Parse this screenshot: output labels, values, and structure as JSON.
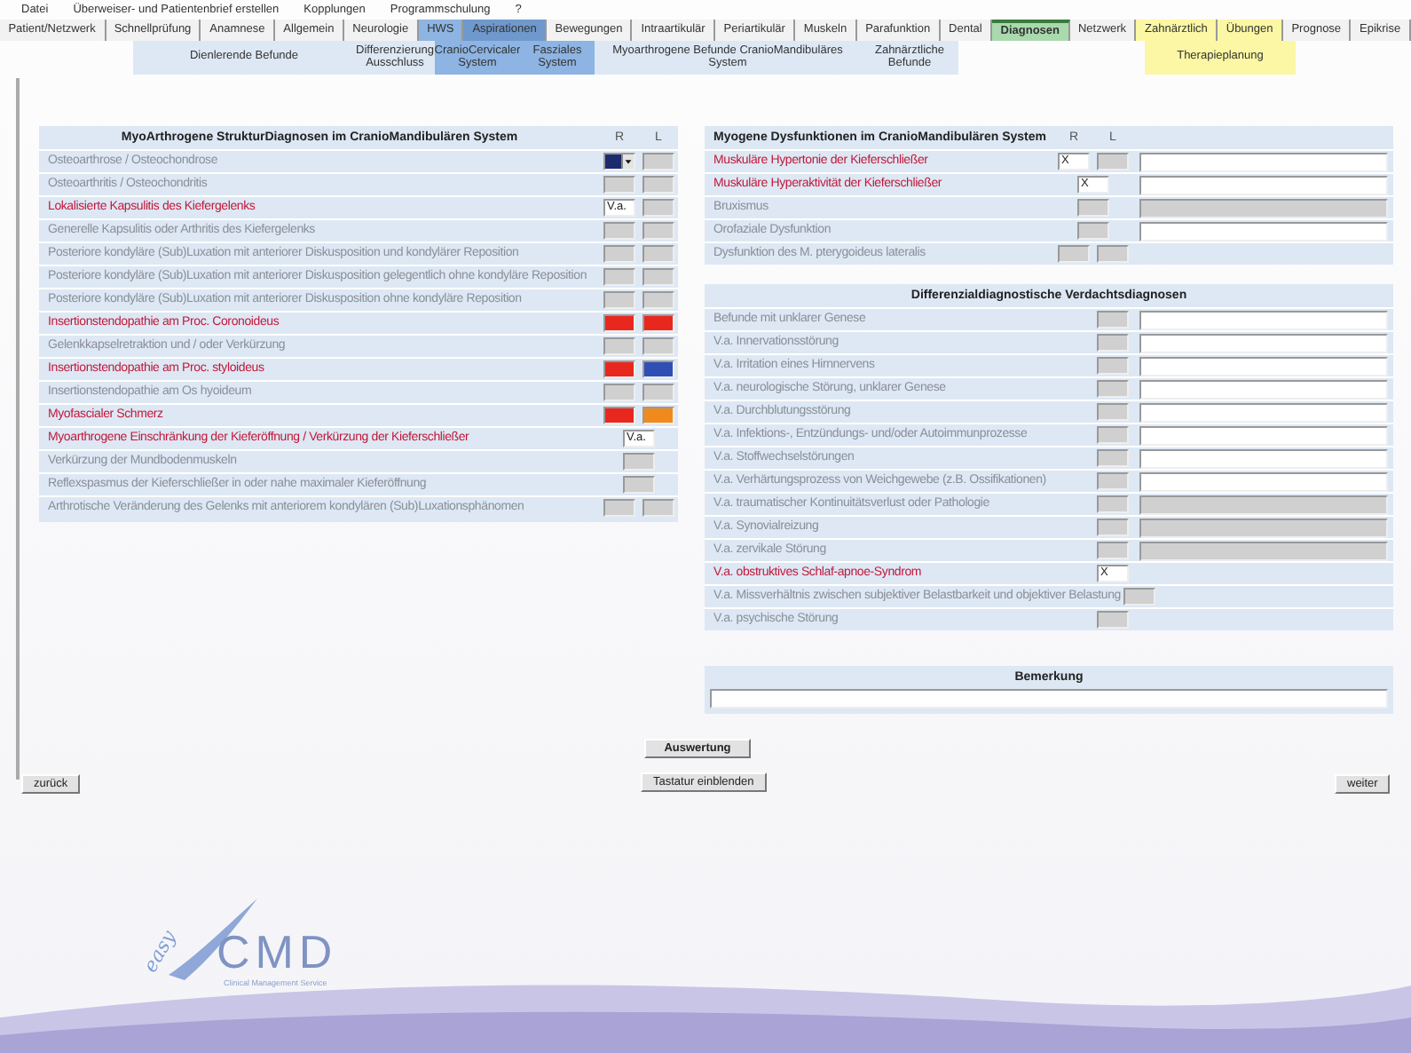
{
  "menu": [
    "Datei",
    "Überweiser- und Patientenbrief erstellen",
    "Kopplungen",
    "Programmschulung",
    "?"
  ],
  "tabs": [
    {
      "label": "Patient/Netzwerk",
      "color": "#f2f2f2",
      "selected": false
    },
    {
      "label": "Schnellprüfung",
      "color": "#f2f2f2",
      "selected": false
    },
    {
      "label": "Anamnese",
      "color": "#f2f2f2",
      "selected": false
    },
    {
      "label": "Allgemein",
      "color": "#f2f2f2",
      "selected": false
    },
    {
      "label": "Neurologie",
      "color": "#f2f2f2",
      "selected": false
    },
    {
      "label": "HWS",
      "color": "#8db4e2",
      "selected": false
    },
    {
      "label": "Aspirationen",
      "color": "#6f98cc",
      "selected": false
    },
    {
      "label": "Bewegungen",
      "color": "#f2f2f2",
      "selected": false
    },
    {
      "label": "Intraartikulär",
      "color": "#f2f2f2",
      "selected": false
    },
    {
      "label": "Periartikulär",
      "color": "#f2f2f2",
      "selected": false
    },
    {
      "label": "Muskeln",
      "color": "#f2f2f2",
      "selected": false
    },
    {
      "label": "Parafunktion",
      "color": "#f2f2f2",
      "selected": false
    },
    {
      "label": "Dental",
      "color": "#f2f2f2",
      "selected": false
    },
    {
      "label": "Diagnosen",
      "color": "#a9d9ad",
      "selected": true
    },
    {
      "label": "Netzwerk",
      "color": "#f2f2f2",
      "selected": false
    },
    {
      "label": "Zahnärztlich",
      "color": "#fbf7a4",
      "selected": false
    },
    {
      "label": "Übungen",
      "color": "#fbf7a4",
      "selected": false
    },
    {
      "label": "Prognose",
      "color": "#f2f2f2",
      "selected": false
    },
    {
      "label": "Epikrise",
      "color": "#f2f2f2",
      "selected": false
    }
  ],
  "subtab_groups": [
    {
      "items": [
        {
          "label": "Dienlerende Befunde",
          "color": "#dde8f4"
        },
        {
          "label": "Differenzierung Ausschluss",
          "color": "#dde8f4"
        },
        {
          "label": "CranioCervicaler System",
          "color": "#8db4e2"
        },
        {
          "label": "Fasziales System",
          "color": "#8db4e2"
        },
        {
          "label": "Myoarthrogene Befunde CranioMandibuläres System",
          "color": "#dde8f4"
        },
        {
          "label": "Zahnärztliche Befunde",
          "color": "#dde8f4"
        }
      ]
    },
    {
      "items": [
        {
          "label": "Therapieplanung",
          "color": "#fbf7a4"
        }
      ]
    }
  ],
  "left_panel": {
    "title": "MyoArthrogene StrukturDiagnosen im CranioMandibulären System",
    "columns": [
      "R",
      "L"
    ],
    "rows": [
      {
        "label": "Osteoarthrose / Osteochondrose",
        "flagged": false,
        "cells": [
          {
            "kind": "dropdown",
            "color": "#1c2b6e"
          },
          {
            "kind": "blank"
          }
        ]
      },
      {
        "label": "Osteoarthritis / Osteochondritis",
        "flagged": false,
        "cells": [
          {
            "kind": "blank"
          },
          {
            "kind": "blank"
          }
        ]
      },
      {
        "label": "Lokalisierte Kapsulitis des Kiefergelenks",
        "flagged": true,
        "cells": [
          {
            "kind": "entry",
            "value": "V.a."
          },
          {
            "kind": "blank"
          }
        ]
      },
      {
        "label": "Generelle Kapsulitis oder Arthritis des Kiefergelenks",
        "flagged": false,
        "cells": [
          {
            "kind": "blank"
          },
          {
            "kind": "blank"
          }
        ]
      },
      {
        "label": "Posteriore kondyläre (Sub)Luxation mit anteriorer Diskusposition und kondylärer Reposition",
        "flagged": false,
        "cells": [
          {
            "kind": "blank"
          },
          {
            "kind": "blank"
          }
        ]
      },
      {
        "label": "Posteriore kondyläre (Sub)Luxation mit anteriorer Diskusposition gelegentlich ohne kondyläre Reposition",
        "flagged": false,
        "cells": [
          {
            "kind": "blank"
          },
          {
            "kind": "blank"
          }
        ]
      },
      {
        "label": "Posteriore kondyläre (Sub)Luxation mit anteriorer Diskusposition ohne kondyläre Reposition",
        "flagged": false,
        "cells": [
          {
            "kind": "blank"
          },
          {
            "kind": "blank"
          }
        ]
      },
      {
        "label": "Insertionstendopathie am Proc. Coronoideus",
        "flagged": true,
        "cells": [
          {
            "kind": "color",
            "color": "#e8281e"
          },
          {
            "kind": "color",
            "color": "#e8281e"
          }
        ]
      },
      {
        "label": "Gelenkkapselretraktion und / oder Verkürzung",
        "flagged": false,
        "cells": [
          {
            "kind": "blank"
          },
          {
            "kind": "blank"
          }
        ]
      },
      {
        "label": "Insertionstendopathie am Proc. styloideus",
        "flagged": true,
        "cells": [
          {
            "kind": "color",
            "color": "#e8281e"
          },
          {
            "kind": "color",
            "color": "#2f4fb5"
          }
        ]
      },
      {
        "label": "Insertionstendopathie am Os hyoideum",
        "flagged": false,
        "cells": [
          {
            "kind": "blank"
          },
          {
            "kind": "blank"
          }
        ]
      },
      {
        "label": "Myofascialer Schmerz",
        "flagged": true,
        "cells": [
          {
            "kind": "color",
            "color": "#e8281e"
          },
          {
            "kind": "color",
            "color": "#f08a1c"
          }
        ]
      },
      {
        "label": "Myoarthrogene Einschränkung der Kieferöffnung / Verkürzung der Kieferschließer",
        "flagged": true,
        "cells": [
          {
            "kind": "entry",
            "value": "V.a."
          }
        ]
      },
      {
        "label": "Verkürzung der Mundbodenmuskeln",
        "flagged": false,
        "cells": [
          {
            "kind": "blank"
          }
        ]
      },
      {
        "label": "Reflexspasmus der Kieferschließer in oder nahe maximaler Kieferöffnung",
        "flagged": false,
        "cells": [
          {
            "kind": "blank"
          }
        ]
      },
      {
        "label": "Arthrotische Veränderung des Gelenks mit anteriorem kondylären (Sub)Luxationsphänomen",
        "flagged": false,
        "cells": [
          {
            "kind": "blank"
          },
          {
            "kind": "blank"
          }
        ]
      }
    ]
  },
  "myogene_panel": {
    "title": "Myogene Dysfunktionen im CranioMandibulären System",
    "columns": [
      "R",
      "L"
    ],
    "rows": [
      {
        "label": "Muskuläre Hypertonie der Kieferschließer",
        "flagged": true,
        "cells": [
          {
            "kind": "entry",
            "value": "X"
          },
          {
            "kind": "blank"
          }
        ],
        "note": {
          "disabled": false
        }
      },
      {
        "label": "Muskuläre Hyperaktivität der Kieferschließer",
        "flagged": true,
        "cells": [
          {
            "kind": "entry",
            "value": "X"
          }
        ],
        "note": {
          "disabled": false
        }
      },
      {
        "label": "Bruxismus",
        "flagged": false,
        "cells": [
          {
            "kind": "blank"
          }
        ],
        "note": {
          "disabled": true
        }
      },
      {
        "label": "Orofaziale Dysfunktion",
        "flagged": false,
        "cells": [
          {
            "kind": "blank"
          }
        ],
        "note": {
          "disabled": false
        }
      },
      {
        "label": "Dysfunktion des M. pterygoideus lateralis",
        "flagged": false,
        "cells": [
          {
            "kind": "blank"
          },
          {
            "kind": "blank"
          }
        ]
      }
    ]
  },
  "differential_panel": {
    "title": "Differenzialdiagnostische Verdachtsdiagnosen",
    "rows": [
      {
        "label": "Befunde mit unklarer Genese",
        "flagged": false,
        "cells": [
          {
            "kind": "blank"
          }
        ],
        "note": {
          "disabled": false
        }
      },
      {
        "label": "V.a. Innervationsstörung",
        "flagged": false,
        "cells": [
          {
            "kind": "blank"
          }
        ],
        "note": {
          "disabled": false
        }
      },
      {
        "label": "V.a. Irritation eines Hirnnervens",
        "flagged": false,
        "cells": [
          {
            "kind": "blank"
          }
        ],
        "note": {
          "disabled": false
        }
      },
      {
        "label": "V.a. neurologische Störung, unklarer Genese",
        "flagged": false,
        "cells": [
          {
            "kind": "blank"
          }
        ],
        "note": {
          "disabled": false
        }
      },
      {
        "label": "V.a. Durchblutungsstörung",
        "flagged": false,
        "cells": [
          {
            "kind": "blank"
          }
        ],
        "note": {
          "disabled": false
        }
      },
      {
        "label": "V.a. Infektions-, Entzündungs- und/oder Autoimmunprozesse",
        "flagged": false,
        "cells": [
          {
            "kind": "blank"
          }
        ],
        "note": {
          "disabled": false
        }
      },
      {
        "label": "V.a. Stoffwechselstörungen",
        "flagged": false,
        "cells": [
          {
            "kind": "blank"
          }
        ],
        "note": {
          "disabled": false
        }
      },
      {
        "label": "V.a. Verhärtungsprozess von Weichgewebe (z.B. Ossifikationen)",
        "flagged": false,
        "cells": [
          {
            "kind": "blank"
          }
        ],
        "note": {
          "disabled": false
        }
      },
      {
        "label": "V.a. traumatischer Kontinuitätsverlust oder Pathologie",
        "flagged": false,
        "cells": [
          {
            "kind": "blank"
          }
        ],
        "note": {
          "disabled": true
        }
      },
      {
        "label": "V.a. Synovialreizung",
        "flagged": false,
        "cells": [
          {
            "kind": "blank"
          }
        ],
        "note": {
          "disabled": true
        }
      },
      {
        "label": "V.a. zervikale Störung",
        "flagged": false,
        "cells": [
          {
            "kind": "blank"
          }
        ],
        "note": {
          "disabled": true
        }
      },
      {
        "label": "V.a. obstruktives Schlaf-apnoe-Syndrom",
        "flagged": true,
        "cells": [
          {
            "kind": "entry",
            "value": "X"
          }
        ]
      },
      {
        "label": "V.a. Missverhältnis zwischen subjektiver Belastbarkeit und objektiver Belastung",
        "flagged": false,
        "cells": [
          {
            "kind": "blank"
          }
        ]
      },
      {
        "label": "V.a. psychische Störung",
        "flagged": false,
        "cells": [
          {
            "kind": "blank"
          }
        ]
      }
    ]
  },
  "remark_panel": {
    "title": "Bemerkung"
  },
  "evaluate_button": "Auswertung",
  "keyboard_button": "Tastatur einblenden",
  "back_button": "zurück",
  "next_button": "weiter",
  "logo": {
    "script": "easy",
    "letters": "CMD",
    "tagline": "Clinical Management Service"
  }
}
